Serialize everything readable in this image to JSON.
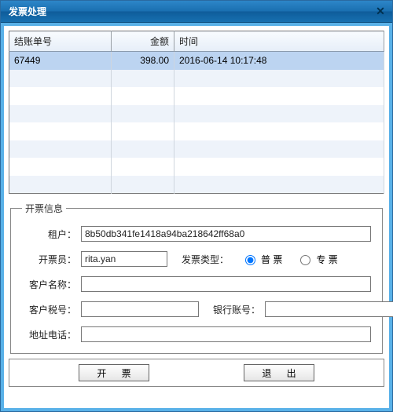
{
  "title": "发票处理",
  "table": {
    "headers": {
      "bill_no": "结账单号",
      "amount": "金额",
      "time": "时间"
    },
    "rows": [
      {
        "bill_no": "67449",
        "amount": "398.00",
        "time": "2016-06-14 10:17:48",
        "selected": true
      }
    ],
    "visible_rows": 8
  },
  "section": {
    "legend": "开票信息",
    "labels": {
      "tenant": "租户：",
      "cashier": "开票员：",
      "invoice_type": "发票类型：",
      "customer_name": "客户名称：",
      "customer_tax": "客户税号：",
      "bank_acct": "银行账号：",
      "addr_phone": "地址电话："
    },
    "values": {
      "tenant": "8b50db341fe1418a94ba218642ff68a0",
      "cashier": "rita.yan",
      "customer_name": "",
      "customer_tax": "",
      "bank_acct": "",
      "addr_phone": ""
    },
    "invoice_type": {
      "options": [
        {
          "key": "normal",
          "label": "普 票",
          "selected": true
        },
        {
          "key": "special",
          "label": "专 票",
          "selected": false
        }
      ]
    }
  },
  "buttons": {
    "issue": "开 票",
    "exit": "退 出"
  }
}
